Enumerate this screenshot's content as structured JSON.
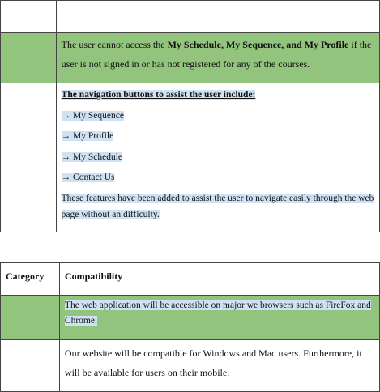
{
  "table1": {
    "row2_text_pre": "The user cannot access the ",
    "row2_text_bold": "My Schedule, My Sequence, and My Profile",
    "row2_text_post": " if the user is not signed in or has not registered for any of the courses.",
    "nav_heading": "The navigation buttons to assist the user include:",
    "nav_items": [
      "→ My Sequence",
      "→ My Profile",
      "→ My Schedule",
      "→ Contact Us"
    ],
    "nav_note": "These features have been added to assist the user to navigate easily through the web page without an difficulty."
  },
  "table2": {
    "col1_header": "Category",
    "col2_header": "Compatibility",
    "row2_text": "The web application will be accessible on major we browsers such   as FireFox and Chrome.",
    "row3_text": "Our website will be compatible for Windows and Mac users. Furthermore, it will be available for users on their mobile."
  },
  "colors": {
    "row_green": "#93c47d",
    "selection": "#cfe2f3",
    "border": "#444444"
  }
}
